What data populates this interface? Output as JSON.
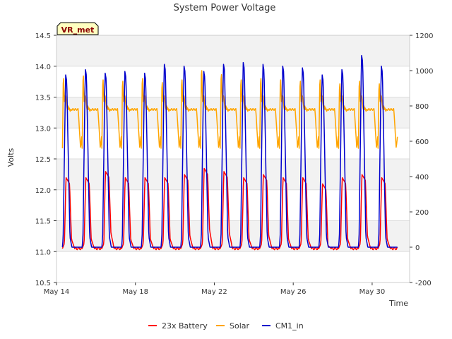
{
  "chart_data": {
    "type": "line",
    "title": "System Power Voltage",
    "xlabel": "Time",
    "ylabel": "Volts",
    "x_range_days": [
      14,
      31.9
    ],
    "x_tick_days": [
      14,
      18,
      22,
      26,
      30
    ],
    "x_tick_labels": [
      "May 14",
      "May 18",
      "May 22",
      "May 26",
      "May 30"
    ],
    "ylim": [
      10.5,
      14.5
    ],
    "y_ticks": [
      10.5,
      11.0,
      11.5,
      12.0,
      12.5,
      13.0,
      13.5,
      14.0,
      14.5
    ],
    "y_tick_labels": [
      "10.5",
      "11.0",
      "11.5",
      "12.0",
      "12.5",
      "13.0",
      "13.5",
      "14.0",
      "14.5"
    ],
    "y2lim": [
      -200,
      1200
    ],
    "y2_ticks": [
      -200,
      0,
      200,
      400,
      600,
      800,
      1000,
      1200
    ],
    "y2_tick_labels": [
      "-200",
      "0",
      "200",
      "400",
      "600",
      "800",
      "1000",
      "1200"
    ],
    "grid": true,
    "band_colors": [
      "#f2f2f2",
      "#ffffff"
    ],
    "site_label": "VR_met",
    "legend_position": "bottom",
    "series": [
      {
        "name": "23x Battery",
        "axis": "left",
        "color": "#ff0000",
        "day_start": 14.3,
        "days": 17,
        "peaks": [
          12.2,
          12.2,
          12.3,
          12.2,
          12.2,
          12.2,
          12.25,
          12.35,
          12.3,
          12.2,
          12.25,
          12.2,
          12.2,
          12.1,
          12.2,
          12.25,
          12.2
        ],
        "base": 11.05
      },
      {
        "name": "Solar",
        "axis": "right",
        "color": "#ffa500",
        "day_start": 14.3,
        "days": 17,
        "peaks": [
          1000,
          1020,
          990,
          980,
          1000,
          970,
          990,
          1060,
          1030,
          990,
          1000,
          990,
          980,
          990,
          960,
          980,
          960
        ],
        "plateau": 780,
        "trough": 560
      },
      {
        "name": "CM1_in",
        "axis": "right",
        "color": "#0000cc",
        "day_start": 14.3,
        "days": 17,
        "peaks": [
          980,
          1010,
          990,
          1000,
          990,
          1040,
          1030,
          1000,
          1040,
          1050,
          1040,
          1030,
          1020,
          980,
          1010,
          1090,
          1030
        ],
        "base": 0
      }
    ]
  }
}
